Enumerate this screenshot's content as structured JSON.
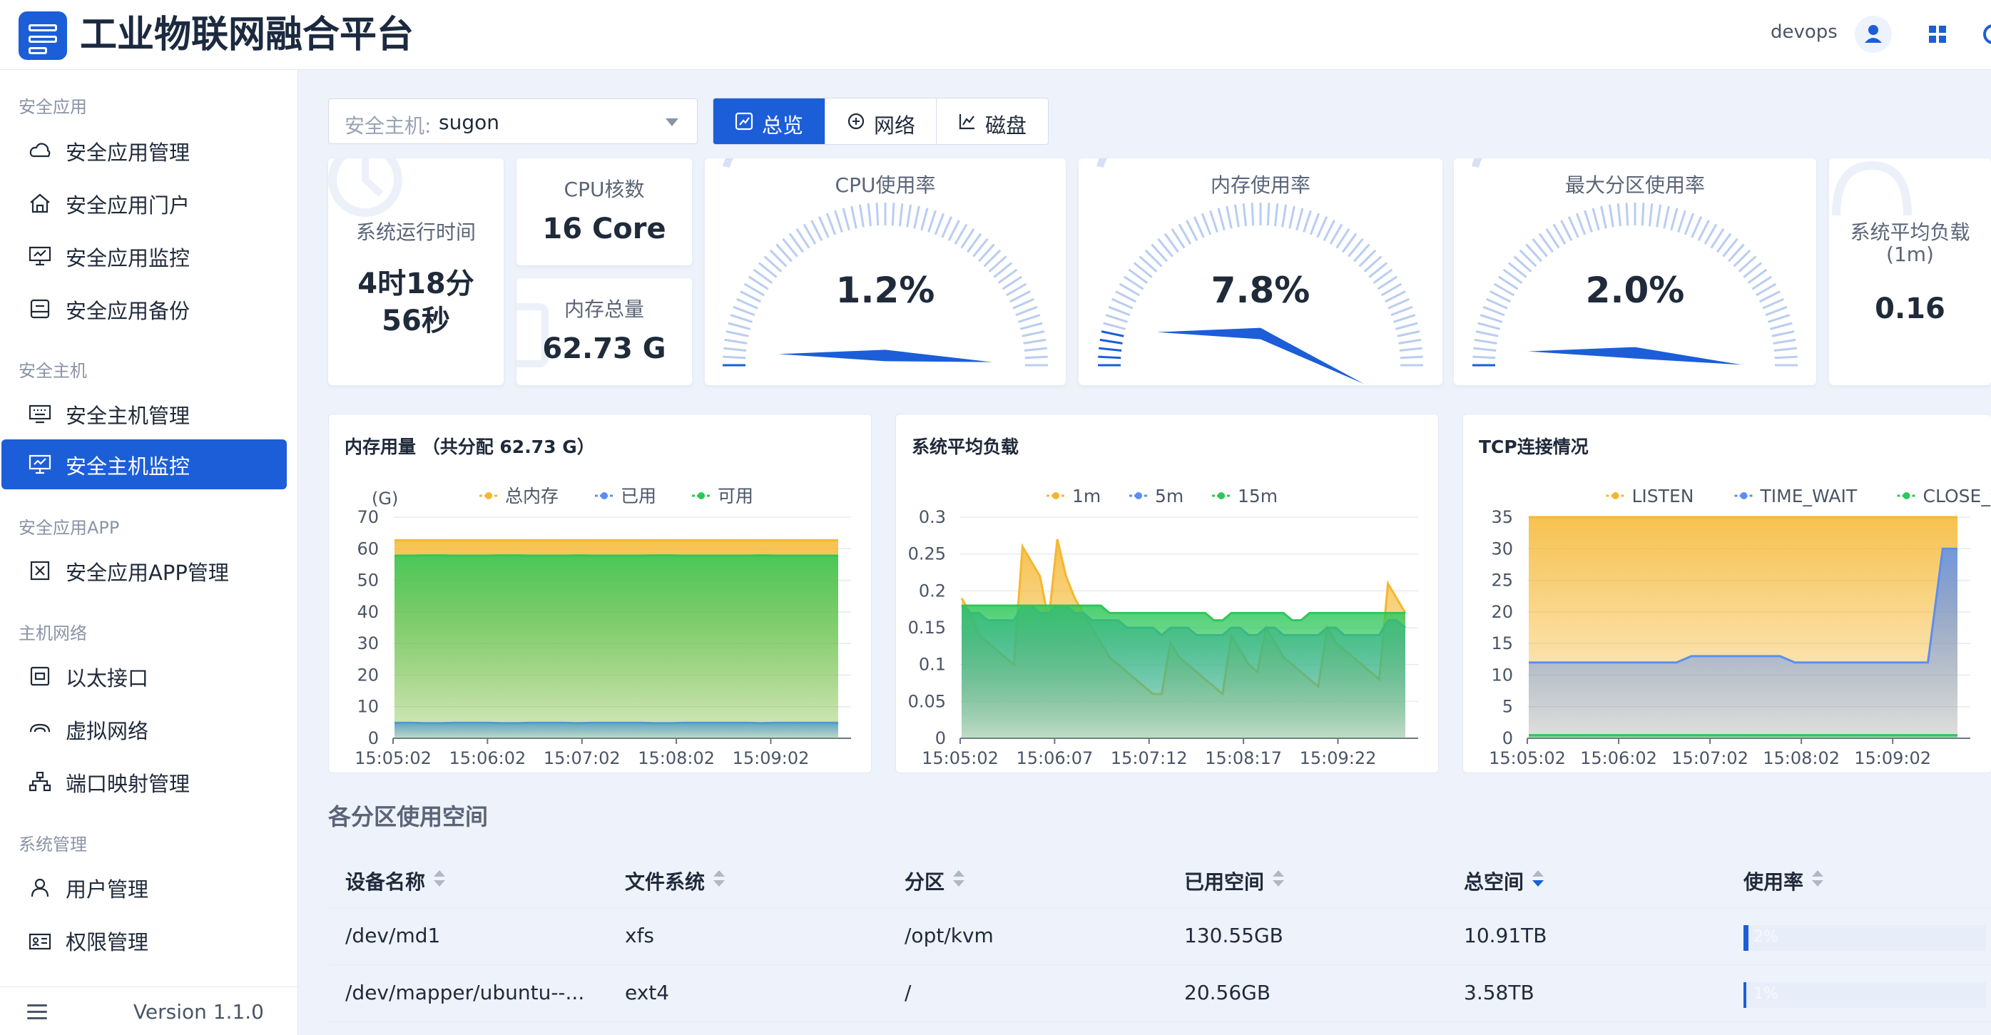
{
  "header": {
    "title": "工业物联网融合平台",
    "user": "devops"
  },
  "sidebar": {
    "groups": [
      {
        "label": "安全应用",
        "items": [
          "安全应用管理",
          "安全应用门户",
          "安全应用监控",
          "安全应用备份"
        ]
      },
      {
        "label": "安全主机",
        "items": [
          "安全主机管理",
          "安全主机监控"
        ]
      },
      {
        "label": "安全应用APP",
        "items": [
          "安全应用APP管理"
        ]
      },
      {
        "label": "主机网络",
        "items": [
          "以太接口",
          "虚拟网络",
          "端口映射管理"
        ]
      },
      {
        "label": "系统管理",
        "items": [
          "用户管理",
          "权限管理"
        ]
      }
    ],
    "active": "安全主机监控",
    "version": "Version 1.1.0"
  },
  "host": {
    "label": "安全主机:",
    "value": "sugon"
  },
  "tabs": [
    {
      "label": "总览",
      "icon": "dashboard-icon"
    },
    {
      "label": "网络",
      "icon": "network-icon"
    },
    {
      "label": "磁盘",
      "icon": "disk-chart-icon"
    }
  ],
  "stats": {
    "uptime": {
      "title": "系统运行时间",
      "value": "4时18分56秒"
    },
    "cpu_cores": {
      "title": "CPU核数",
      "value": "16 Core"
    },
    "mem_total": {
      "title": "内存总量",
      "value": "62.73 G"
    },
    "cpu_usage": {
      "title": "CPU使用率",
      "value": "1.2%",
      "pct": 1.2
    },
    "mem_usage": {
      "title": "内存使用率",
      "value": "7.8%",
      "pct": 7.8
    },
    "max_part": {
      "title": "最大分区使用率",
      "value": "2.0%",
      "pct": 2.0
    },
    "load": {
      "title": "系统平均负载",
      "subtitle": "(1m)",
      "value": "0.16"
    }
  },
  "chart_data": [
    {
      "type": "area",
      "title": "内存用量 （共分配 62.73 G）",
      "ylabel": "(G)",
      "ylim": [
        0,
        70
      ],
      "yticks": [
        0,
        10,
        20,
        30,
        40,
        50,
        60,
        70
      ],
      "xticks": [
        "15:05:02",
        "15:06:02",
        "15:07:02",
        "15:08:02",
        "15:09:02"
      ],
      "series": [
        {
          "name": "总内存",
          "color": "#f5b731",
          "values": [
            62.7,
            62.7,
            62.7,
            62.7,
            62.7,
            62.7,
            62.7,
            62.7,
            62.7,
            62.7,
            62.7,
            62.7,
            62.7,
            62.7,
            62.7,
            62.7,
            62.7,
            62.7,
            62.7,
            62.7,
            62.7,
            62.7,
            62.7,
            62.7,
            62.7,
            62.7,
            62.7,
            62.7,
            62.7,
            62.7
          ]
        },
        {
          "name": "已用",
          "color": "#5b8ff0",
          "values": [
            4.9,
            4.9,
            4.8,
            4.8,
            4.9,
            4.9,
            4.9,
            4.8,
            4.8,
            4.9,
            4.9,
            4.9,
            4.8,
            4.9,
            4.9,
            4.9,
            4.9,
            4.8,
            4.8,
            4.9,
            4.9,
            4.9,
            4.9,
            4.9,
            4.8,
            4.9,
            4.9,
            4.9,
            4.9,
            4.9
          ]
        },
        {
          "name": "可用",
          "color": "#2ec75a",
          "values": [
            57.8,
            57.8,
            57.9,
            57.9,
            57.8,
            57.8,
            57.8,
            57.9,
            57.9,
            57.8,
            57.8,
            57.8,
            57.9,
            57.8,
            57.8,
            57.8,
            57.8,
            57.9,
            57.9,
            57.8,
            57.8,
            57.8,
            57.8,
            57.8,
            57.9,
            57.8,
            57.8,
            57.8,
            57.8,
            57.8
          ]
        }
      ]
    },
    {
      "type": "area",
      "title": "系统平均负载",
      "ylim": [
        0,
        0.3
      ],
      "yticks": [
        0,
        0.05,
        0.1,
        0.15,
        0.2,
        0.25,
        0.3
      ],
      "xticks": [
        "15:05:02",
        "15:06:07",
        "15:07:12",
        "15:08:17",
        "15:09:22"
      ],
      "series": [
        {
          "name": "1m",
          "color": "#f5b731",
          "values": [
            0.19,
            0.17,
            0.14,
            0.13,
            0.12,
            0.11,
            0.1,
            0.26,
            0.24,
            0.22,
            0.16,
            0.27,
            0.22,
            0.19,
            0.17,
            0.15,
            0.13,
            0.11,
            0.1,
            0.09,
            0.08,
            0.07,
            0.06,
            0.06,
            0.13,
            0.11,
            0.1,
            0.09,
            0.08,
            0.07,
            0.06,
            0.14,
            0.12,
            0.1,
            0.09,
            0.15,
            0.13,
            0.11,
            0.1,
            0.09,
            0.08,
            0.07,
            0.15,
            0.13,
            0.12,
            0.11,
            0.1,
            0.09,
            0.08,
            0.21,
            0.19,
            0.17
          ]
        },
        {
          "name": "5m",
          "color": "#5b8ff0",
          "values": [
            0.18,
            0.17,
            0.17,
            0.16,
            0.16,
            0.16,
            0.16,
            0.18,
            0.18,
            0.17,
            0.17,
            0.18,
            0.18,
            0.17,
            0.17,
            0.16,
            0.16,
            0.16,
            0.16,
            0.15,
            0.15,
            0.15,
            0.15,
            0.14,
            0.15,
            0.15,
            0.15,
            0.14,
            0.14,
            0.14,
            0.14,
            0.15,
            0.15,
            0.14,
            0.14,
            0.15,
            0.15,
            0.14,
            0.14,
            0.14,
            0.14,
            0.14,
            0.15,
            0.15,
            0.14,
            0.14,
            0.14,
            0.14,
            0.14,
            0.16,
            0.16,
            0.15
          ]
        },
        {
          "name": "15m",
          "color": "#2ec75a",
          "values": [
            0.18,
            0.18,
            0.18,
            0.18,
            0.18,
            0.18,
            0.18,
            0.18,
            0.18,
            0.18,
            0.18,
            0.18,
            0.18,
            0.18,
            0.18,
            0.18,
            0.18,
            0.17,
            0.17,
            0.17,
            0.17,
            0.17,
            0.17,
            0.17,
            0.17,
            0.17,
            0.17,
            0.17,
            0.17,
            0.16,
            0.16,
            0.17,
            0.17,
            0.17,
            0.17,
            0.17,
            0.17,
            0.17,
            0.16,
            0.16,
            0.17,
            0.17,
            0.17,
            0.17,
            0.17,
            0.17,
            0.17,
            0.17,
            0.17,
            0.17,
            0.17,
            0.17
          ]
        }
      ]
    },
    {
      "type": "area",
      "title": "TCP连接情况",
      "ylim": [
        0,
        35
      ],
      "yticks": [
        0,
        5,
        10,
        15,
        20,
        25,
        30,
        35
      ],
      "xticks": [
        "15:05:02",
        "15:06:02",
        "15:07:02",
        "15:08:02",
        "15:09:02"
      ],
      "series": [
        {
          "name": "LISTEN",
          "color": "#f5b731",
          "values": [
            35,
            35,
            35,
            35,
            35,
            35,
            35,
            35,
            35,
            35,
            35,
            35,
            35,
            35,
            35,
            35,
            35,
            35,
            35,
            35,
            35,
            35,
            35,
            35,
            35,
            35,
            35,
            35,
            35,
            35
          ]
        },
        {
          "name": "TIME_WAIT",
          "color": "#5b8ff0",
          "values": [
            12,
            12,
            12,
            12,
            12,
            12,
            12,
            12,
            12,
            12,
            12,
            13,
            13,
            13,
            13,
            13,
            13,
            13,
            12,
            12,
            12,
            12,
            12,
            12,
            12,
            12,
            12,
            12,
            30,
            30
          ]
        },
        {
          "name": "CLOSE_WAIT",
          "color": "#2ec75a",
          "values": [
            0.5,
            0.5,
            0.5,
            0.5,
            0.5,
            0.5,
            0.5,
            0.5,
            0.5,
            0.5,
            0.5,
            0.5,
            0.5,
            0.5,
            0.5,
            0.5,
            0.5,
            0.5,
            0.5,
            0.5,
            0.5,
            0.5,
            0.5,
            0.5,
            0.5,
            0.5,
            0.5,
            0.5,
            0.5,
            0.5
          ]
        }
      ]
    }
  ],
  "partitions": {
    "title": "各分区使用空间",
    "columns": [
      "设备名称",
      "文件系统",
      "分区",
      "已用空间",
      "总空间",
      "使用率"
    ],
    "rows": [
      {
        "device": "/dev/md1",
        "fs": "xfs",
        "mount": "/opt/kvm",
        "used": "130.55GB",
        "total": "10.91TB",
        "usage": "2%",
        "pct": 2
      },
      {
        "device": "/dev/mapper/ubuntu--...",
        "fs": "ext4",
        "mount": "/",
        "used": "20.56GB",
        "total": "3.58TB",
        "usage": "1%",
        "pct": 1
      }
    ]
  }
}
